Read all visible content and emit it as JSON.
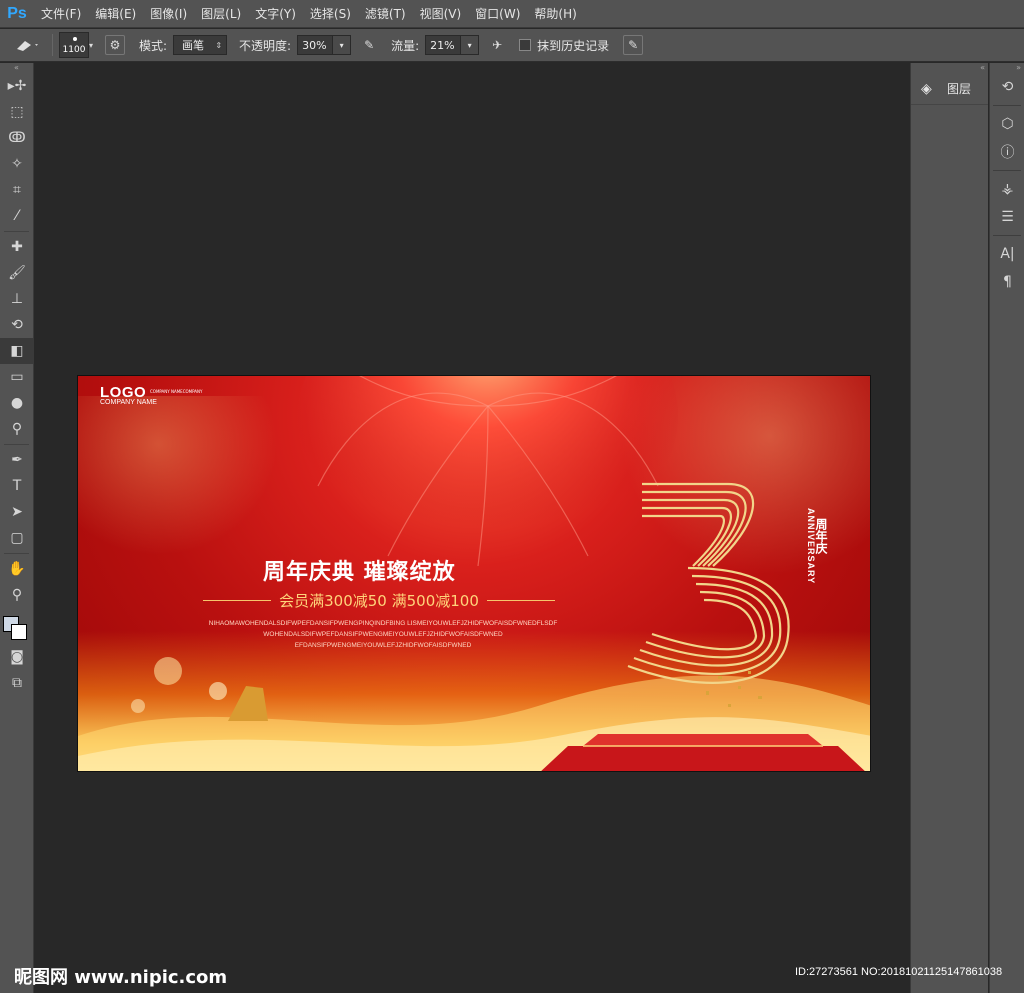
{
  "app": {
    "logo": "Ps"
  },
  "menu": [
    "文件(F)",
    "编辑(E)",
    "图像(I)",
    "图层(L)",
    "文字(Y)",
    "选择(S)",
    "滤镜(T)",
    "视图(V)",
    "窗口(W)",
    "帮助(H)"
  ],
  "options": {
    "brush_size": "1100",
    "mode_label": "模式:",
    "mode_value": "画笔",
    "opacity_label": "不透明度:",
    "opacity_value": "30%",
    "flow_label": "流量:",
    "flow_value": "21%",
    "erase_history_label": "抹到历史记录"
  },
  "panels": {
    "layers_label": "图层"
  },
  "banner": {
    "logo": "LOGO",
    "company": "COMPANY NAME",
    "company_tag": "COMPANY NAMECOMPANY",
    "headline": "周年庆典  璀璨绽放",
    "offer": "会员满300减50 满500减100",
    "small_text_1": "NIHAOMAWOHENDALSDIFWPEFDANSIFPWENGPINQINDFBING LISMEIYOUWLEFJZHIDFWOFAISDFWNEDFLSDF",
    "small_text_2": "WOHENDALSDIFWPEFDANSIFPWENGMEIYOUWLEFJZHIDFWOFAISDFWNED",
    "small_text_3": "EFDANSIFPWENGMEIYOUWLEFJZHIDFWOFAISDFWNED",
    "anniversary": "ANNIVERSARY",
    "zhounianqing": "周年庆"
  },
  "watermark": {
    "site": "昵图网 www.nipic.com",
    "id": "ID:27273561 NO:20181021125147861038"
  },
  "colors": {
    "accent_gold": "#f6c56c",
    "banner_red": "#c8161a",
    "foreground_swatch": "#cfd9e6",
    "background_swatch": "#ffffff"
  }
}
